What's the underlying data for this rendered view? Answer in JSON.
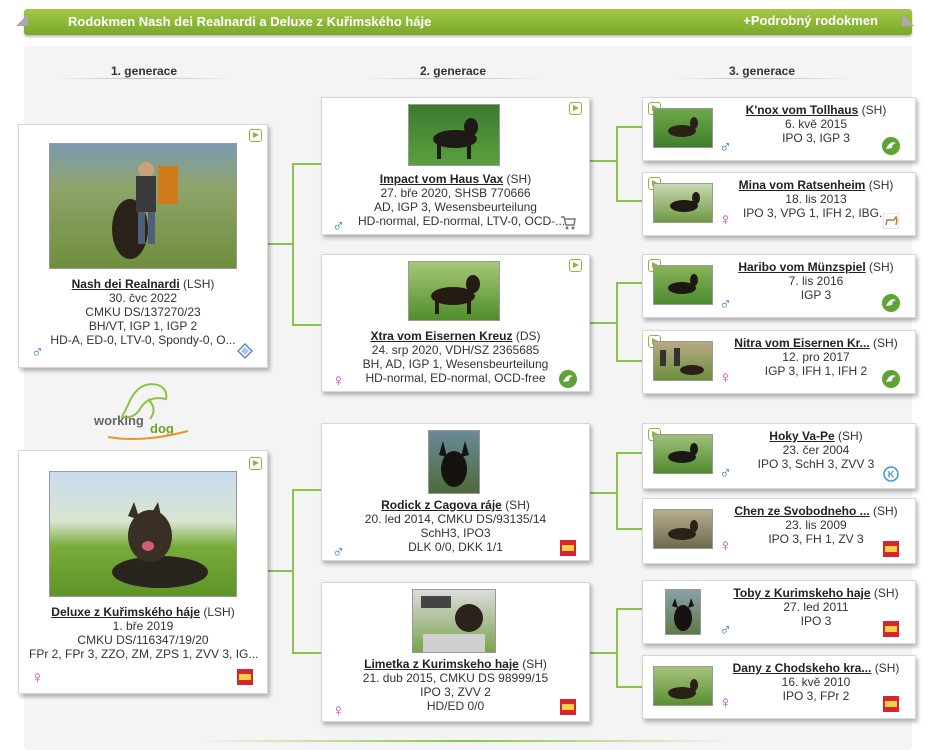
{
  "header": {
    "title": "Rodokmen Nash dei Realnardi a Deluxe z Kuřimského háje",
    "detail_link": "+Podrobný rodokmen"
  },
  "generations": [
    "1. generace",
    "2. generace",
    "3. generace"
  ],
  "logo_text": [
    "working",
    "dog"
  ],
  "dogs": {
    "g1_sire": {
      "name": "Nash dei Realnardi",
      "code": "(LSH)",
      "lines": [
        "30. čvc 2022",
        "CMKU DS/137270/23",
        "BH/VT, IGP 1, IGP 2",
        "HD-A, ED-0, LTV-0, Spondy-0, O..."
      ]
    },
    "g1_dam": {
      "name": "Deluxe z Kuřimského háje",
      "code": "(LSH)",
      "lines": [
        "1. bře 2019",
        "CMKU DS/116347/19/20",
        "FPr 2, FPr 3, ZZO, ZM, ZPS 1, ZVV 3, IG..."
      ]
    },
    "g2_a": {
      "name": "Impact vom Haus Vax",
      "code": "(SH)",
      "lines": [
        "27. bře 2020, SHSB 770666",
        "AD, IGP 3, Wesensbeurteilung",
        "HD-normal, ED-normal, LTV-0, OCD-..."
      ]
    },
    "g2_b": {
      "name": "Xtra vom Eisernen Kreuz",
      "code": "(DS)",
      "lines": [
        "24. srp 2020, VDH/SZ 2365685",
        "BH, AD, IGP 1, Wesensbeurteilung",
        "HD-normal, ED-normal, OCD-free"
      ]
    },
    "g2_c": {
      "name": "Rodick z Cagova ráje",
      "code": "(SH)",
      "lines": [
        "20. led 2014, CMKU DS/93135/14",
        "SchH3, IPO3",
        "DLK 0/0, DKK 1/1"
      ]
    },
    "g2_d": {
      "name": "Limetka z Kurimskeho haje",
      "code": "(SH)",
      "lines": [
        "21. dub 2015, CMKU DS 98999/15",
        "IPO 3, ZVV 2",
        "HD/ED 0/0"
      ]
    },
    "g3_1": {
      "name": "K'nox vom Tollhaus",
      "code": "(SH)",
      "lines": [
        "6. kvě 2015",
        "IPO 3, IGP 3"
      ]
    },
    "g3_2": {
      "name": "Mina vom Ratsenheim",
      "code": "(SH)",
      "lines": [
        "18. lis 2013",
        "IPO 3, VPG 1, IFH 2, IBG..."
      ]
    },
    "g3_3": {
      "name": "Haribo vom Münzspiel",
      "code": "(SH)",
      "lines": [
        "7. lis 2016",
        "IGP 3"
      ]
    },
    "g3_4": {
      "name": "Nitra vom Eisernen Kr...",
      "code": "(SH)",
      "lines": [
        "12. pro 2017",
        "IGP 3, IFH 1, IFH 2"
      ]
    },
    "g3_5": {
      "name": "Hoky Va-Pe",
      "code": "(SH)",
      "lines": [
        "23. čer 2004",
        "IPO 3, SchH 3, ZVV 3"
      ]
    },
    "g3_6": {
      "name": "Chen ze Svobodneho ...",
      "code": "(SH)",
      "lines": [
        "23. lis 2009",
        "IPO 3, FH 1, ZV 3"
      ]
    },
    "g3_7": {
      "name": "Toby z Kurimskeho haje",
      "code": "(SH)",
      "lines": [
        "27. led 2011",
        "IPO 3"
      ]
    },
    "g3_8": {
      "name": "Dany z Chodskeho kra...",
      "code": "(SH)",
      "lines": [
        "16. kvě 2010",
        "IPO 3, FPr 2"
      ]
    }
  },
  "symbols": {
    "male": "♂",
    "female": "♀"
  },
  "colors": {
    "header_green": "#8cb83a",
    "connector_green": "#8bc34a",
    "male_blue": "#2f7bbf",
    "female_magenta": "#c23dae"
  }
}
